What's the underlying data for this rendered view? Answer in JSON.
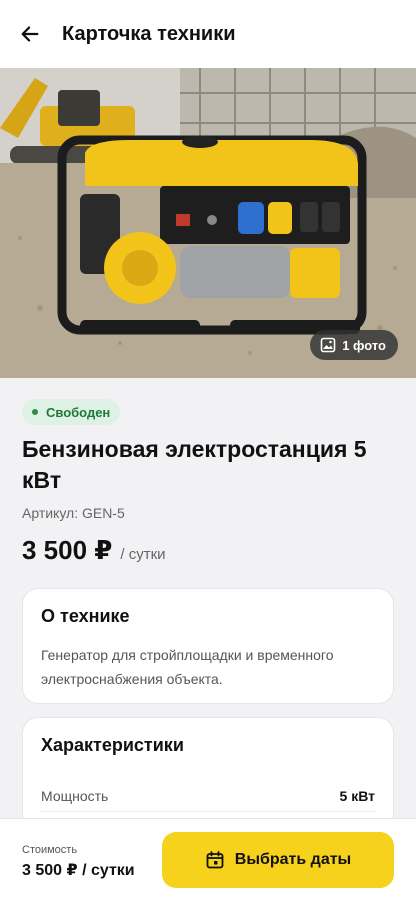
{
  "header": {
    "title": "Карточка техники"
  },
  "photo": {
    "count_label": "1 фото"
  },
  "product": {
    "status": "Свободен",
    "title": "Бензиновая электростанция 5 кВт",
    "sku": "Артикул: GEN-5",
    "price": "3 500 ₽",
    "price_unit": "/ сутки"
  },
  "about": {
    "title": "О технике",
    "text": "Генератор для стройплощадки и временного электроснабжения объекта."
  },
  "specs": {
    "title": "Характеристики",
    "rows": [
      {
        "label": "Мощность",
        "value": "5 кВт"
      }
    ]
  },
  "bottom_bar": {
    "cost_label": "Стоимость",
    "cost_value": "3 500 ₽ / сутки",
    "cta_label": "Выбрать даты"
  },
  "colors": {
    "accent": "#f7d21c",
    "status_bg": "#dff1e4",
    "status_text": "#1f7a3a"
  },
  "icons": {
    "back": "arrow-left-icon",
    "photo": "image-icon",
    "calendar": "calendar-icon"
  }
}
